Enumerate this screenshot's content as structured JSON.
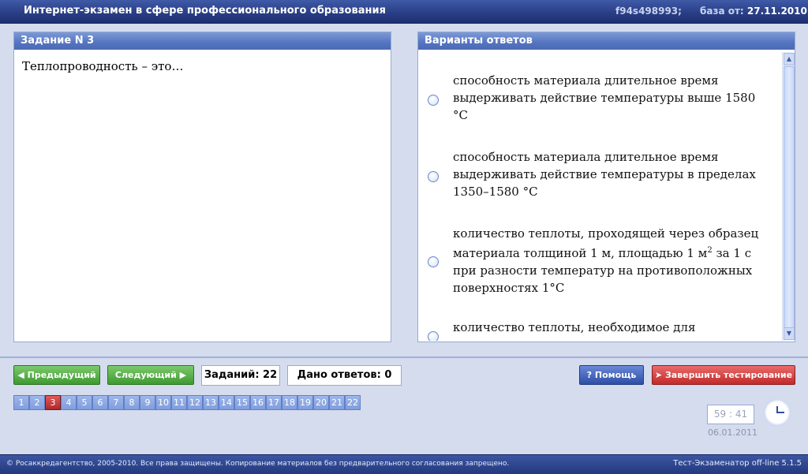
{
  "titlebar": {
    "title": "Интернет-экзамен в сфере профессионального образования",
    "code": "f94s498993;",
    "db_label": "база от:",
    "db_date": "27.11.2010"
  },
  "task": {
    "header": "Задание N 3",
    "question": "Теплопроводность – это…"
  },
  "answers": {
    "header": "Варианты ответов",
    "options": [
      {
        "text": "способность материала длительное время выдерживать действие температуры выше 1580 °С"
      },
      {
        "text": "способность материала длительное время выдерживать действие температуры в пределах 1350–1580 °С"
      },
      {
        "text_before": "количество теплоты, проходящей через образец материала толщиной 1 м, площадью 1 м",
        "sup": "2",
        "text_after": " за 1 с при разности температур на противоположных поверхностях 1°С"
      },
      {
        "text": "количество теплоты, необходимое для"
      }
    ]
  },
  "nav": {
    "prev_label": "Предыдущий",
    "next_label": "Следующий",
    "tasks_count": "Заданий: 22",
    "answers_given": "Дано ответов: 0",
    "help_label": "Помощь",
    "finish_label": "Завершить тестирование"
  },
  "pages": [
    "1",
    "2",
    "3",
    "4",
    "5",
    "6",
    "7",
    "8",
    "9",
    "10",
    "11",
    "12",
    "13",
    "14",
    "15",
    "16",
    "17",
    "18",
    "19",
    "20",
    "21",
    "22"
  ],
  "current_page": "3",
  "timer": "59 : 41",
  "date": "06.01.2011",
  "footer": {
    "copyright": "© Росаккредагентство, 2005-2010. Все права защищены. Копирование материалов без предварительного согласования запрещено.",
    "version": "Тест-Экзаменатор off-line 5.1.5"
  },
  "colors": {
    "titlebar": "#2a3f87",
    "panel_header": "#5474c1",
    "active_page": "#b02828",
    "green_button": "#3f9a2f",
    "red_button": "#c22a2a"
  }
}
